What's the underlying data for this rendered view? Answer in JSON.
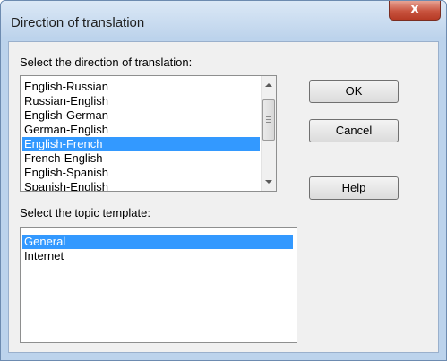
{
  "window": {
    "title": "Direction of translation",
    "close_glyph": "x"
  },
  "direction": {
    "label": "Select the direction of translation:",
    "items": [
      "English-Russian",
      "Russian-English",
      "English-German",
      "German-English",
      "English-French",
      "French-English",
      "English-Spanish",
      "Spanish-English"
    ],
    "selected_index": 4
  },
  "topic": {
    "label": "Select the topic template:",
    "items": [
      "General",
      "Internet"
    ],
    "selected_index": 0
  },
  "buttons": {
    "ok": "OK",
    "cancel": "Cancel",
    "help": "Help"
  },
  "colors": {
    "selection": "#3399ff",
    "title_bar": "#bed4ec",
    "close_button": "#c8533e"
  }
}
